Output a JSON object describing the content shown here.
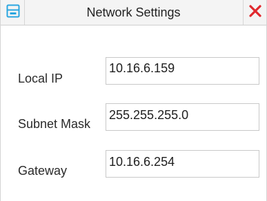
{
  "window": {
    "title": "Network Settings"
  },
  "toolbar": {
    "save_icon": "save-icon",
    "close_icon": "close-icon",
    "accent_color": "#2aa6e0",
    "close_color": "#e0282d"
  },
  "fields": {
    "local_ip": {
      "label": "Local IP",
      "value": "10.16.6.159"
    },
    "subnet_mask": {
      "label": "Subnet Mask",
      "value": "255.255.255.0"
    },
    "gateway": {
      "label": "Gateway",
      "value": "10.16.6.254"
    }
  }
}
